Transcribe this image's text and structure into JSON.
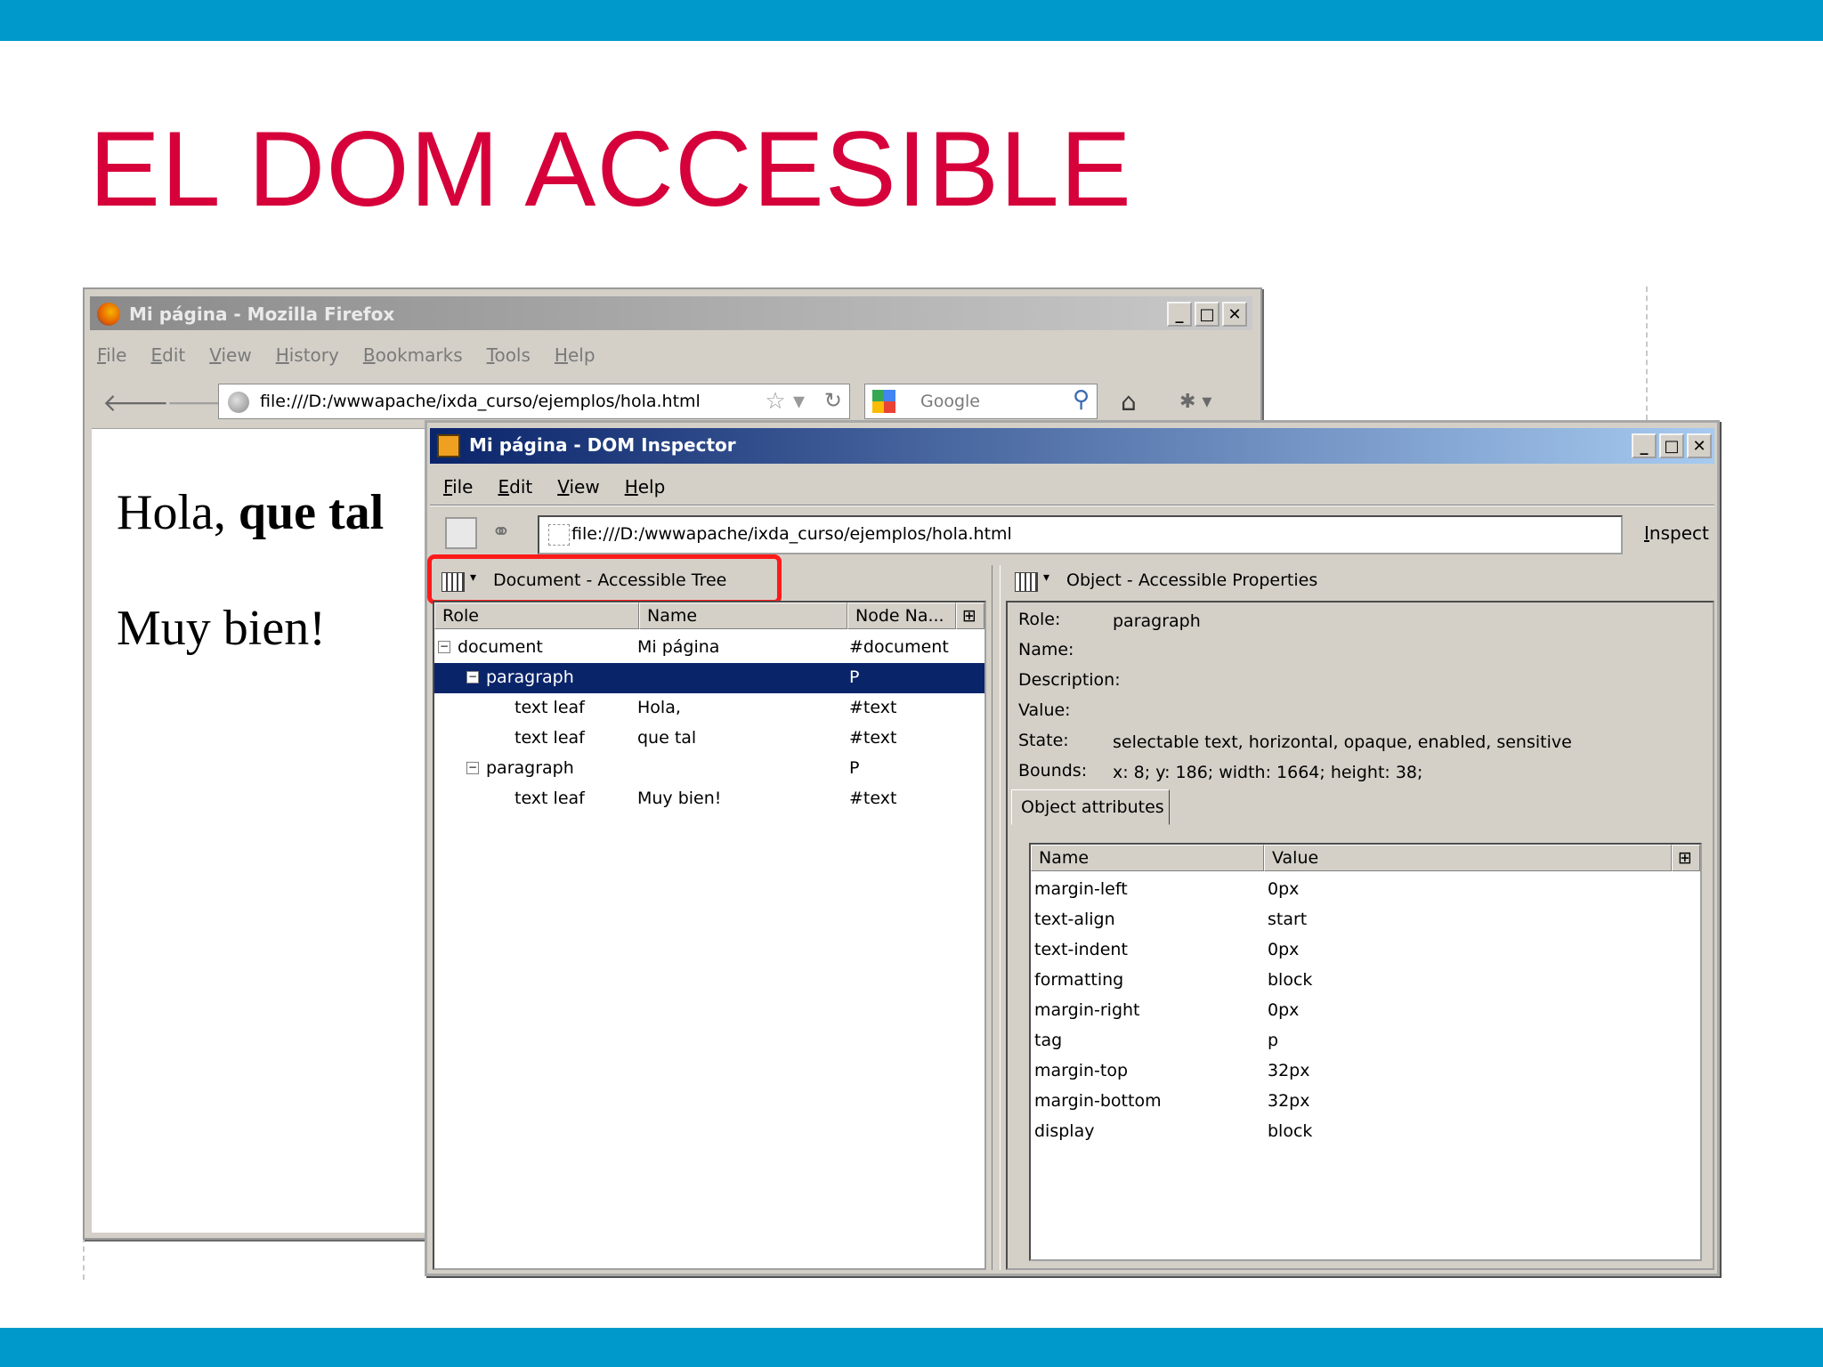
{
  "slide": {
    "title": "EL DOM ACCESIBLE"
  },
  "firefox": {
    "title": "Mi página - Mozilla Firefox",
    "menu": [
      "File",
      "Edit",
      "View",
      "History",
      "Bookmarks",
      "Tools",
      "Help"
    ],
    "url": "file:///D:/wwwapache/ixda_curso/ejemplos/hola.html",
    "search_placeholder": "Google",
    "content": {
      "hola": "Hola, ",
      "que_tal": "que tal",
      "muy_bien": "Muy bien!"
    }
  },
  "inspector": {
    "title": "Mi página - DOM Inspector",
    "menu": [
      "File",
      "Edit",
      "View",
      "Help"
    ],
    "url": "file:///D:/wwwapache/ixda_curso/ejemplos/hola.html",
    "inspect_label": "Inspect",
    "left_panel_title": "Document - Accessible Tree",
    "right_panel_title": "Object - Accessible Properties",
    "tree_columns": [
      "Role",
      "Name",
      "Node Na..."
    ],
    "tree": [
      {
        "role": "document",
        "name": "Mi página",
        "node": "#document"
      },
      {
        "role": "paragraph",
        "name": "",
        "node": "P"
      },
      {
        "role": "text leaf",
        "name": "Hola,",
        "node": "#text"
      },
      {
        "role": "text leaf",
        "name": "que tal",
        "node": "#text"
      },
      {
        "role": "paragraph",
        "name": "",
        "node": "P"
      },
      {
        "role": "text leaf",
        "name": "Muy bien!",
        "node": "#text"
      }
    ],
    "props": {
      "role_label": "Role:",
      "role": "paragraph",
      "name_label": "Name:",
      "name": "",
      "description_label": "Description:",
      "description": "",
      "value_label": "Value:",
      "value": "",
      "state_label": "State:",
      "state": "selectable text, horizontal, opaque, enabled, sensitive",
      "bounds_label": "Bounds:",
      "bounds": "x: 8;  y: 186;  width: 1664;  height: 38;"
    },
    "attr_tab": "Object attributes",
    "attr_columns": [
      "Name",
      "Value"
    ],
    "attributes": [
      {
        "name": "margin-left",
        "value": "0px"
      },
      {
        "name": "text-align",
        "value": "start"
      },
      {
        "name": "text-indent",
        "value": "0px"
      },
      {
        "name": "formatting",
        "value": "block"
      },
      {
        "name": "margin-right",
        "value": "0px"
      },
      {
        "name": "tag",
        "value": "p"
      },
      {
        "name": "margin-top",
        "value": "32px"
      },
      {
        "name": "margin-bottom",
        "value": "32px"
      },
      {
        "name": "display",
        "value": "block"
      }
    ]
  },
  "colors": {
    "accent_bar": "#0099cc",
    "title": "#d6003a",
    "selection": "#0a246a",
    "highlight": "#ff1a1a"
  }
}
